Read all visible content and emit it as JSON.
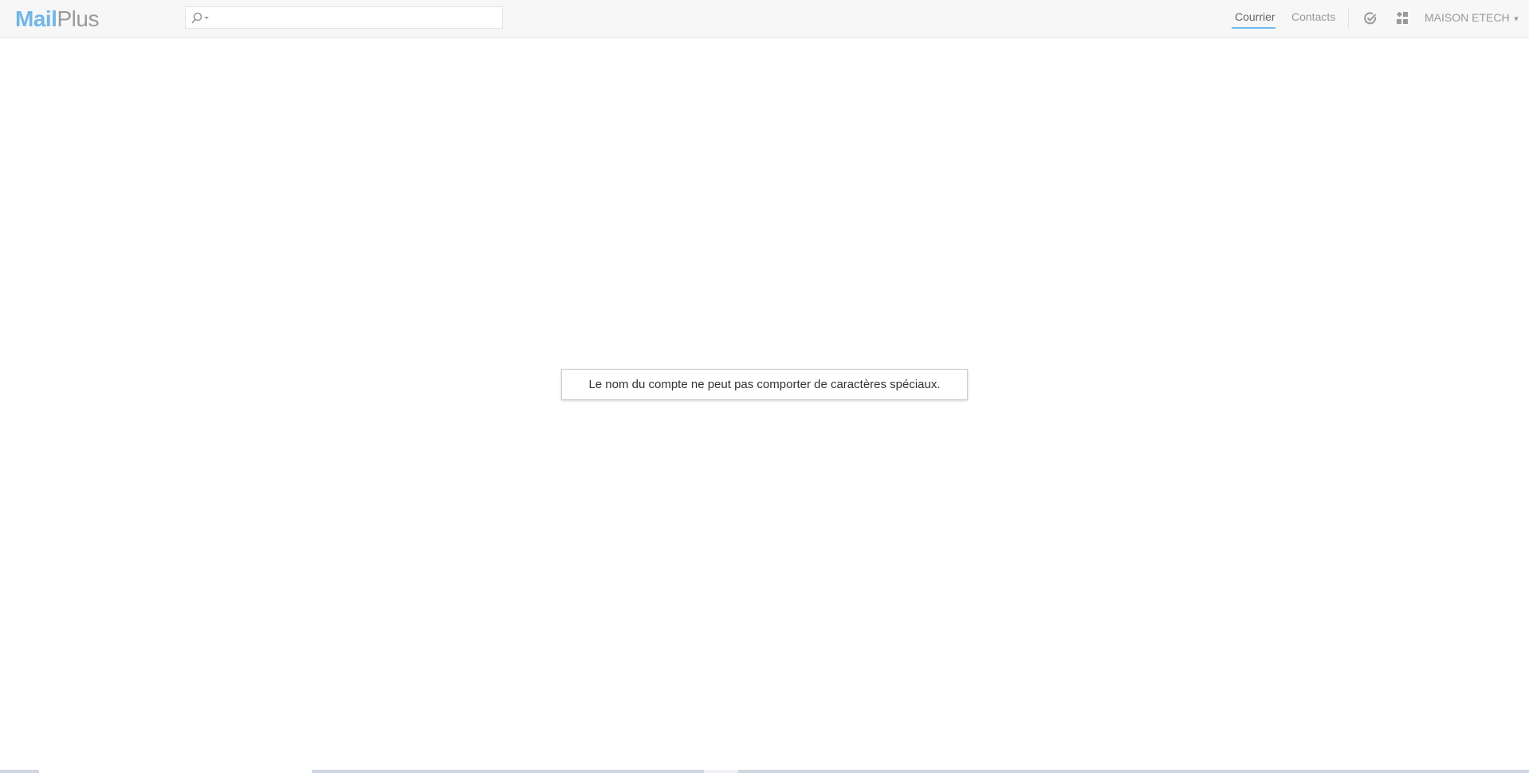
{
  "header": {
    "logo_mail": "Mail",
    "logo_plus": "Plus",
    "search_placeholder": "",
    "nav": [
      {
        "label": "Courrier",
        "active": true
      },
      {
        "label": "Contacts",
        "active": false
      }
    ],
    "user_label": "MAISON ETECH"
  },
  "toast": {
    "message": "Le nom du compte ne peut pas comporter de caractères spéciaux."
  },
  "colors": {
    "accent": "#6fb6ee",
    "header_bg": "#f7f7f7"
  }
}
